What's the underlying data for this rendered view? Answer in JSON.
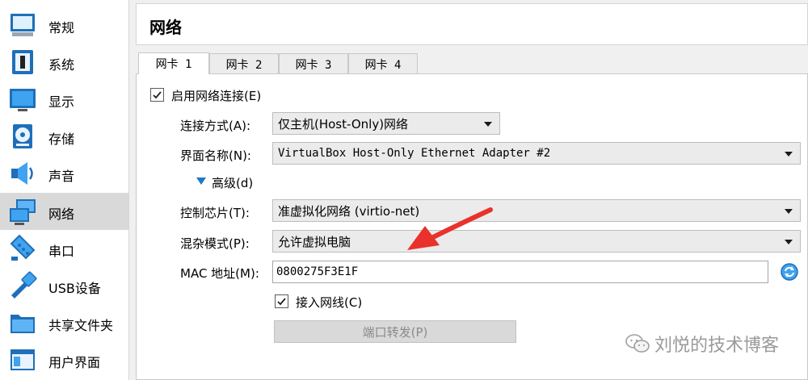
{
  "sidebar": {
    "items": [
      {
        "label": "常规",
        "icon": "monitor-icon"
      },
      {
        "label": "系统",
        "icon": "chip-icon"
      },
      {
        "label": "显示",
        "icon": "display-icon"
      },
      {
        "label": "存储",
        "icon": "disk-icon"
      },
      {
        "label": "声音",
        "icon": "speaker-icon"
      },
      {
        "label": "网络",
        "icon": "network-icon",
        "active": true
      },
      {
        "label": "串口",
        "icon": "serial-port-icon"
      },
      {
        "label": "USB设备",
        "icon": "usb-icon"
      },
      {
        "label": "共享文件夹",
        "icon": "folder-icon"
      },
      {
        "label": "用户界面",
        "icon": "window-icon"
      }
    ]
  },
  "header": {
    "title": "网络"
  },
  "tabs": [
    {
      "label": "网卡 1",
      "active": true
    },
    {
      "label": "网卡 2"
    },
    {
      "label": "网卡 3"
    },
    {
      "label": "网卡 4"
    }
  ],
  "adapter": {
    "enable_label": "启用网络连接(E)",
    "enable_checked": true,
    "attached_label": "连接方式(A):",
    "attached_value": "仅主机(Host-Only)网络",
    "name_label": "界面名称(N):",
    "name_value": "VirtualBox Host-Only Ethernet Adapter #2",
    "advanced_label": "高级(d)",
    "chip_label": "控制芯片(T):",
    "chip_value": "准虚拟化网络 (virtio-net)",
    "promisc_label": "混杂模式(P):",
    "promisc_value": "允许虚拟电脑",
    "mac_label": "MAC 地址(M):",
    "mac_value": "0800275F3E1F",
    "cable_label": "接入网线(C)",
    "cable_checked": true,
    "port_forward_label": "端口转发(P)"
  },
  "watermark": {
    "text": "刘悦的技术博客"
  },
  "colors": {
    "accent": "#1e78c8",
    "arrow": "#e8322b",
    "active_row": "#d9d9d9"
  }
}
